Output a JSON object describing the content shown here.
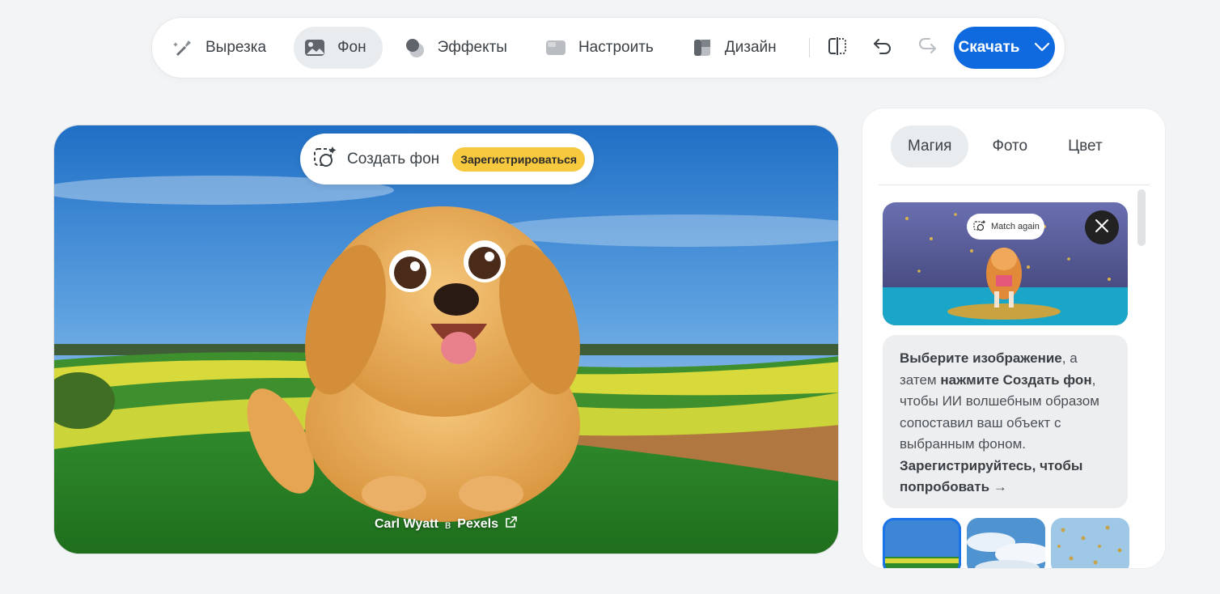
{
  "toolbar": {
    "tools": [
      {
        "label": "Вырезка",
        "icon": "magic-brush-icon",
        "active": false
      },
      {
        "label": "Фон",
        "icon": "image-icon",
        "active": true
      },
      {
        "label": "Эффекты",
        "icon": "effects-icon",
        "active": false
      },
      {
        "label": "Настроить",
        "icon": "adjust-icon",
        "active": false
      },
      {
        "label": "Дизайн",
        "icon": "design-icon",
        "active": false
      }
    ],
    "download_label": "Скачать"
  },
  "canvas": {
    "generate_label": "Создать фон",
    "signup_badge": "Зарегистрироваться",
    "credit_author": "Carl Wyatt",
    "credit_in": "в",
    "credit_site": "Pexels"
  },
  "panel": {
    "tabs": [
      {
        "label": "Магия",
        "active": true
      },
      {
        "label": "Фото",
        "active": false
      },
      {
        "label": "Цвет",
        "active": false
      }
    ],
    "preview": {
      "match_again_label": "Match again"
    },
    "info": {
      "p1_bold": "Выберите изображение",
      "p1": ", а затем ",
      "p2_bold": "нажмите Создать фон",
      "p3": ", чтобы ИИ волшебным образом сопоставил ваш объект с выбранным фоном.",
      "cta": "Зарегистрируйтесь, чтобы попробовать",
      "cta_arrow": "→"
    }
  },
  "colors": {
    "accent": "#0f6ae0",
    "badge": "#f7c93e",
    "active_bg": "#e9ecef"
  }
}
